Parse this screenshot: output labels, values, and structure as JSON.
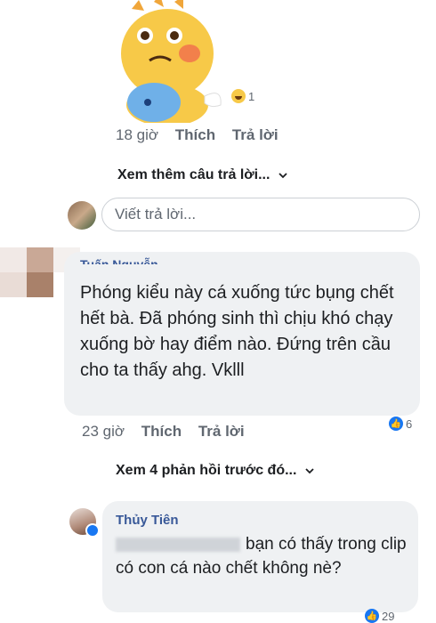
{
  "comment1": {
    "reaction_count": "1",
    "time": "18 giờ",
    "like": "Thích",
    "reply": "Trả lời"
  },
  "more_replies": {
    "label": "Xem thêm câu trả lời...",
    "chevron": "chevron-down-icon"
  },
  "reply_input": {
    "placeholder": "Viết trả lời..."
  },
  "comment2": {
    "author": "Tuấn Nguyễn",
    "text": "Phóng kiểu này cá xuống tức bụng chết hết bà. Đã phóng sinh thì chịu khó chạy xuống bờ hay điểm nào. Đứng trên cầu cho ta thấy ahg. Vklll",
    "like_count": "6",
    "time": "23 giờ",
    "like": "Thích",
    "reply": "Trả lời"
  },
  "previous_replies": {
    "label": "Xem 4 phản hồi trước đó...",
    "chevron": "chevron-down-icon"
  },
  "comment3": {
    "author": "Thủy Tiên",
    "text": "bạn có thấy trong clip có con cá nào chết không nè?",
    "reaction_count": "29"
  },
  "colors": {
    "link": "#385898",
    "bubble": "#eff1f3",
    "meta": "#606770",
    "like_blue": "#1877f2"
  }
}
